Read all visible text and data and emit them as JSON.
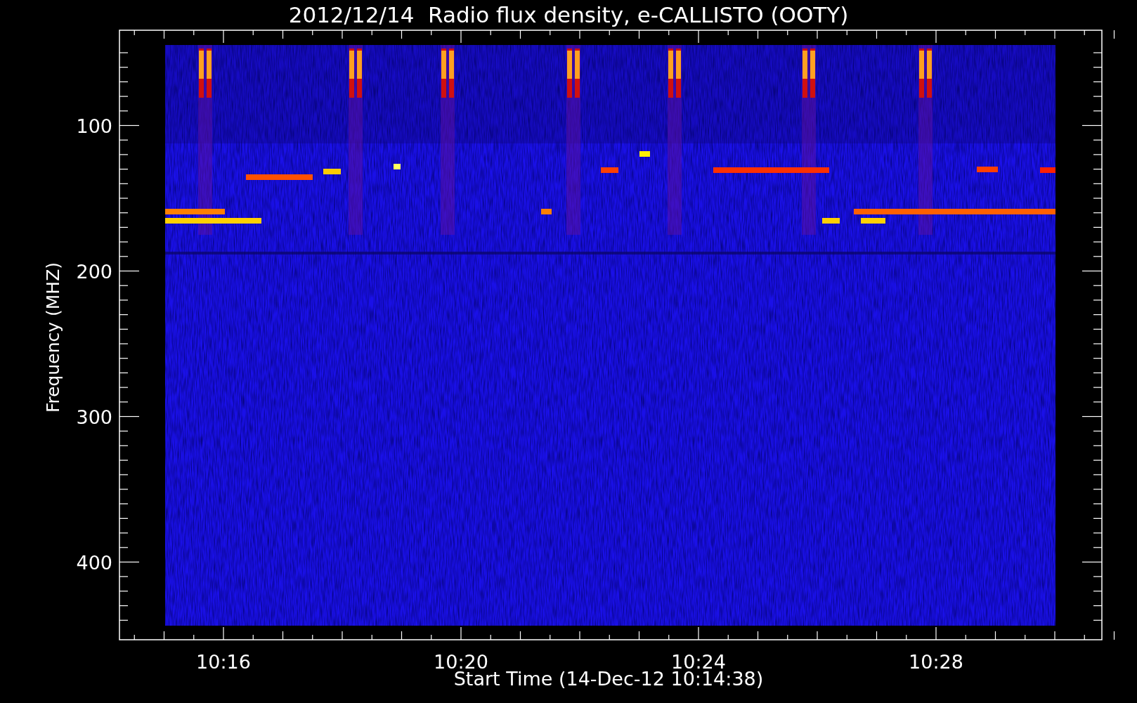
{
  "title": "2012/12/14  Radio flux density, e-CALLISTO (OOTY)",
  "y_axis": {
    "label": "Frequency (MHZ)",
    "ticks": [
      "100",
      "200",
      "300",
      "400"
    ]
  },
  "x_axis": {
    "label": "Start Time (14-Dec-12 10:14:38)",
    "ticks": [
      "10:16",
      "10:20",
      "10:24",
      "10:28"
    ]
  }
}
